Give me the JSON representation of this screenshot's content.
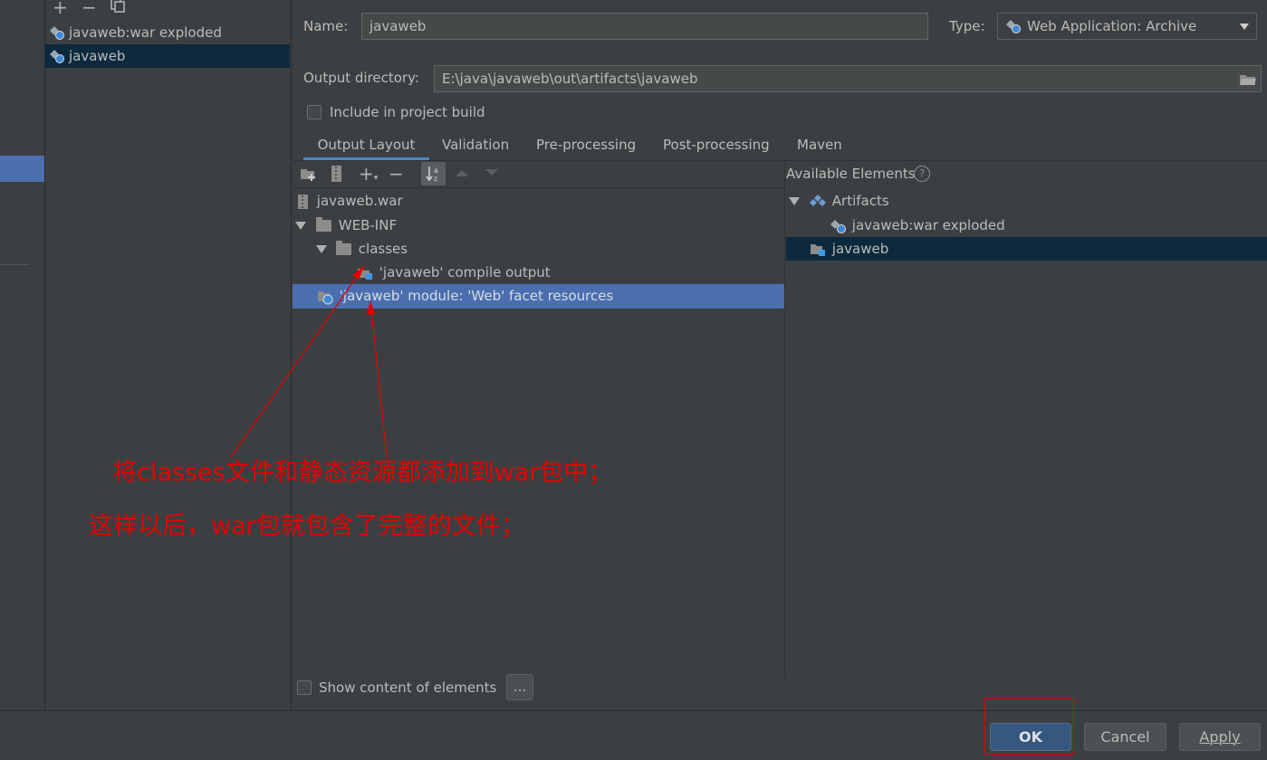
{
  "sidebar": {
    "toolbar": [
      "add-icon",
      "remove-icon",
      "copy-icon"
    ],
    "items": [
      {
        "label": "javaweb:war exploded"
      },
      {
        "label": "javaweb"
      }
    ]
  },
  "form": {
    "name_label": "Name:",
    "name_value": "javaweb",
    "type_label": "Type:",
    "type_value": "Web Application: Archive",
    "output_dir_label": "Output directory:",
    "output_dir_value": "E:\\java\\javaweb\\out\\artifacts\\javaweb",
    "include_build_label": "Include in project build",
    "include_build_checked": false
  },
  "tabs": [
    {
      "label": "Output Layout",
      "active": true
    },
    {
      "label": "Validation"
    },
    {
      "label": "Pre-processing"
    },
    {
      "label": "Post-processing"
    },
    {
      "label": "Maven"
    }
  ],
  "layout_tree": [
    {
      "label": "javaweb.war"
    },
    {
      "label": "WEB-INF"
    },
    {
      "label": "classes"
    },
    {
      "label": "'javaweb' compile output"
    },
    {
      "label": "'javaweb' module: 'Web' facet resources",
      "selected": true
    }
  ],
  "available": {
    "title": "Available Elements",
    "items": [
      {
        "label": "Artifacts"
      },
      {
        "label": "javaweb:war exploded"
      },
      {
        "label": "javaweb"
      }
    ]
  },
  "annotations": {
    "line1": "将classes文件和静态资源都添加到war包中；",
    "line2": "这样以后，war包就包含了完整的文件；"
  },
  "show_content": {
    "label": "Show content of elements",
    "button": "..."
  },
  "buttons": {
    "ok": "OK",
    "cancel": "Cancel",
    "apply": "Apply"
  },
  "colors": {
    "accent": "#4b6eaf",
    "annotation": "#e60000",
    "primary_button": "#365880"
  }
}
